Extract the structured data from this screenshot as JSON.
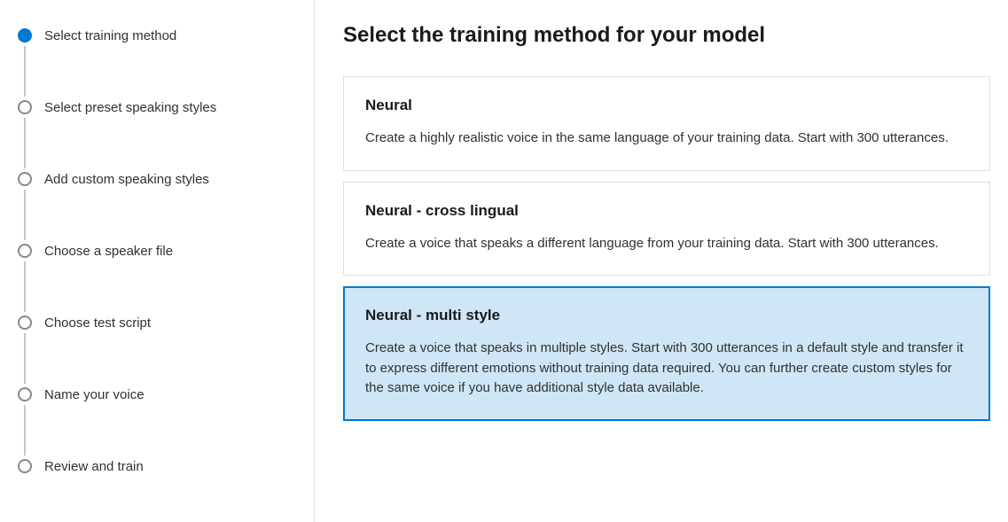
{
  "sidebar": {
    "steps": [
      {
        "label": "Select training method",
        "state": "active"
      },
      {
        "label": "Select preset speaking styles",
        "state": "pending"
      },
      {
        "label": "Add custom speaking styles",
        "state": "pending"
      },
      {
        "label": "Choose a speaker file",
        "state": "pending"
      },
      {
        "label": "Choose test script",
        "state": "pending"
      },
      {
        "label": "Name your voice",
        "state": "pending"
      },
      {
        "label": "Review and train",
        "state": "pending"
      }
    ]
  },
  "main": {
    "title": "Select the training method for your model",
    "options": [
      {
        "title": "Neural",
        "desc": "Create a highly realistic voice in the same language of your training data. Start with 300 utterances.",
        "selected": false
      },
      {
        "title": "Neural - cross lingual",
        "desc": "Create a voice that speaks a different language from your training data. Start with 300 utterances.",
        "selected": false
      },
      {
        "title": "Neural - multi style",
        "desc": "Create a voice that speaks in multiple styles. Start with 300 utterances in a default style and transfer it to express different emotions without training data required. You can further create custom styles for the same voice if you have additional style data available.",
        "selected": true
      }
    ]
  }
}
